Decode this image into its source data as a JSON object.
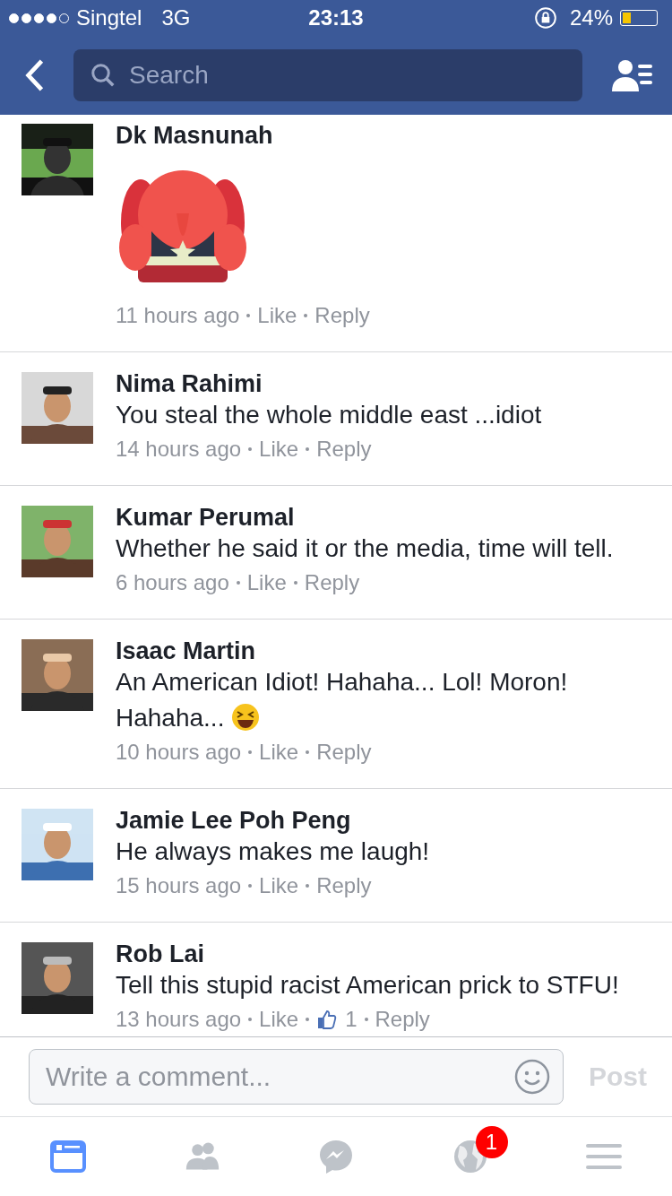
{
  "status_bar": {
    "carrier": "Singtel",
    "network": "3G",
    "time": "23:13",
    "battery": "24%"
  },
  "search": {
    "placeholder": "Search"
  },
  "comments": [
    {
      "name": "Dk Masnunah",
      "sticker": true,
      "time": "11 hours ago",
      "like": "Like",
      "reply": "Reply"
    },
    {
      "name": "Nima Rahimi",
      "text": "You steal the whole middle east ...idiot",
      "time": "14 hours ago",
      "like": "Like",
      "reply": "Reply"
    },
    {
      "name": "Kumar Perumal",
      "text": "Whether he said it or the media, time will tell.",
      "time": "6 hours ago",
      "like": "Like",
      "reply": "Reply"
    },
    {
      "name": "Isaac Martin",
      "text": "An American Idiot! Hahaha... Lol! Moron! Hahaha...",
      "ends_with_emoji": true,
      "time": "10 hours ago",
      "like": "Like",
      "reply": "Reply"
    },
    {
      "name": "Jamie Lee Poh Peng",
      "text": "He always makes me laugh!",
      "time": "15 hours ago",
      "like": "Like",
      "reply": "Reply"
    },
    {
      "name": "Rob Lai",
      "text": "Tell this stupid racist American prick to STFU!",
      "time": "13 hours ago",
      "like": "Like",
      "like_count": "1",
      "reply": "Reply"
    }
  ],
  "composer": {
    "placeholder": "Write a comment...",
    "post": "Post",
    "post_disabled": true
  },
  "tab_bar": [
    {
      "kind": "news-feed",
      "selected": true
    },
    {
      "kind": "friends",
      "selected": false
    },
    {
      "kind": "messenger",
      "selected": false
    },
    {
      "kind": "notifications",
      "selected": false,
      "badge": "1"
    },
    {
      "kind": "menu",
      "selected": false
    }
  ]
}
